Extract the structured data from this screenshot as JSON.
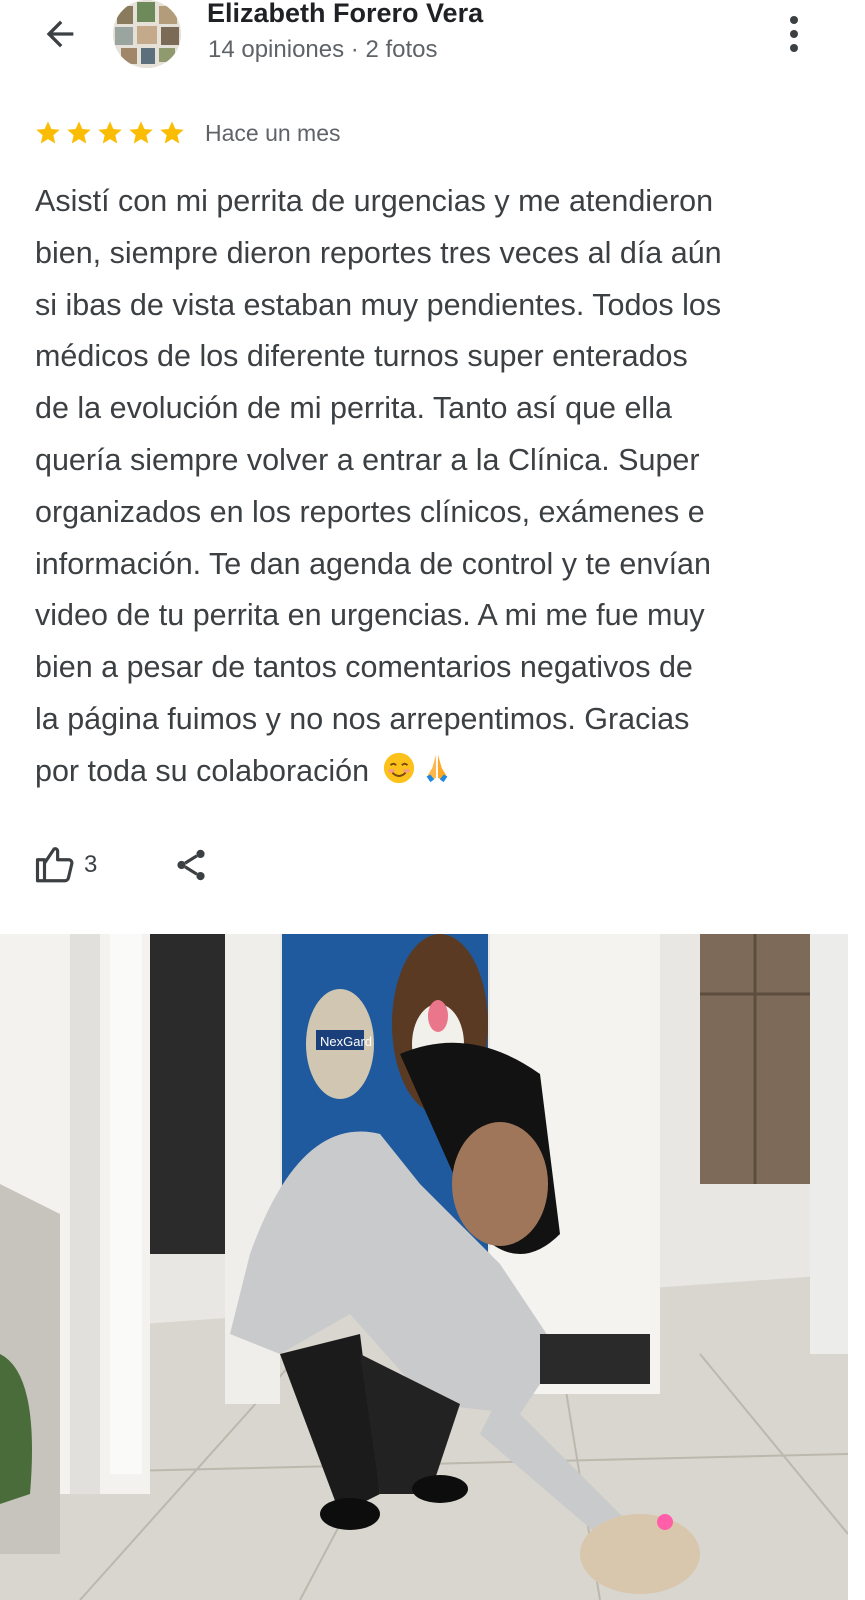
{
  "header": {
    "back_icon": "arrow-left-icon",
    "reviewer_name": "Elizabeth Forero Vera",
    "reviewer_meta": "14 opiniones · 2 fotos",
    "menu_icon": "more-vert-icon"
  },
  "review": {
    "rating": 5,
    "rating_max": 5,
    "star_color": "#fbbc04",
    "time_ago": "Hace un mes",
    "lines": [
      "Asistí con mi perrita de urgencias y me atendieron",
      "bien, siempre dieron reportes tres veces al día aún",
      "si ibas de vista estaban muy pendientes. Todos los",
      "médicos de los diferente turnos super enterados",
      "de la evolución de mi perrita. Tanto así que ella",
      "quería siempre volver a entrar a la Clínica. Super",
      "organizados en los reportes clínicos, exámenes e",
      "información. Te dan agenda de control y te envían",
      "video de tu perrita en urgencias. A mi me fue muy",
      "bien a pesar de tantos comentarios negativos de",
      "la página fuimos y no nos arrepentimos. Gracias",
      "por toda su colaboración"
    ],
    "emojis": [
      "smiling-face-icon",
      "folded-hands-icon"
    ]
  },
  "actions": {
    "like_icon": "thumb-up-icon",
    "like_count": "3",
    "share_icon": "share-icon"
  },
  "photo": {
    "badge_text": "NexGard"
  }
}
